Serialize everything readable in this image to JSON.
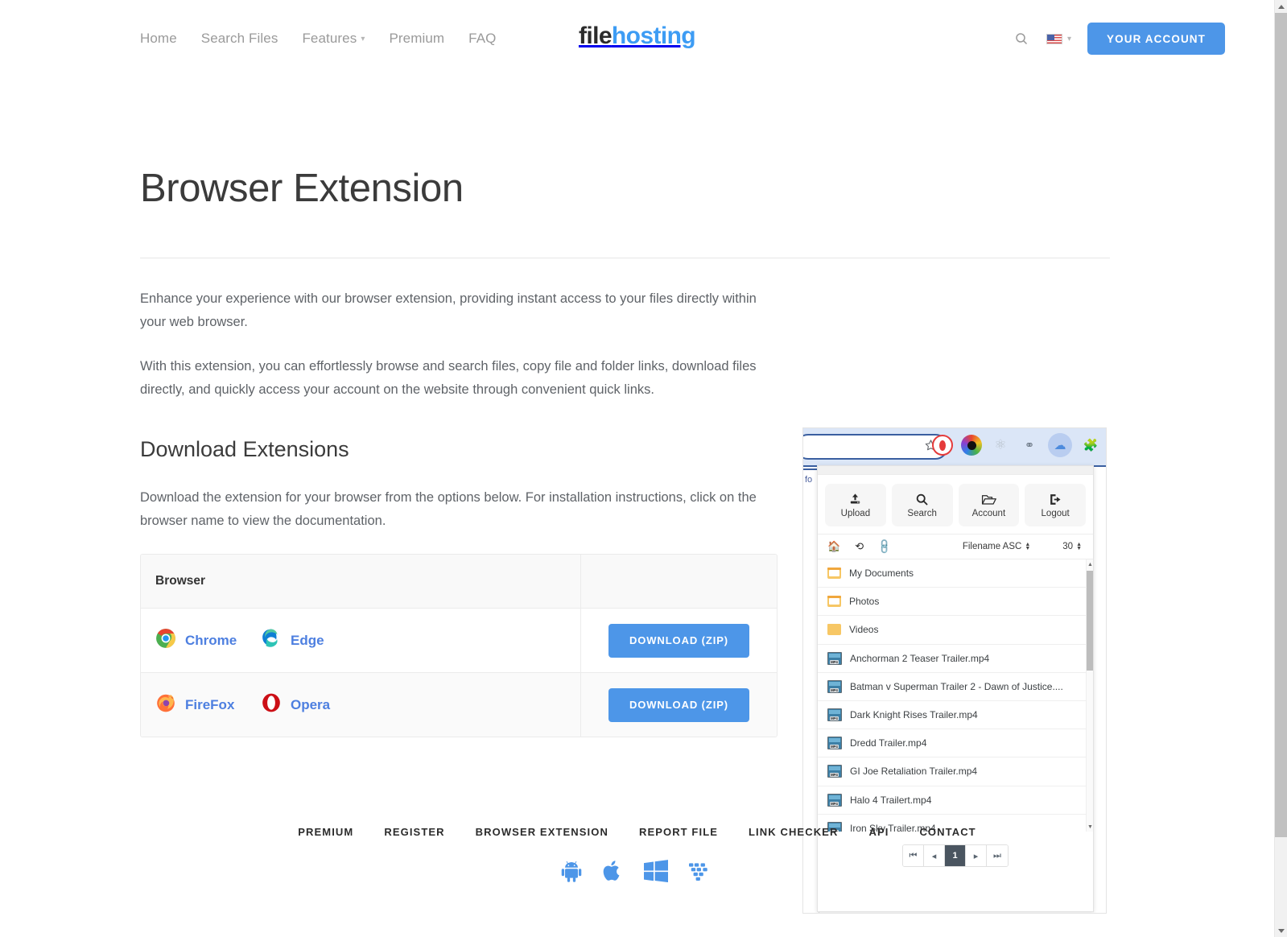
{
  "header": {
    "nav": [
      {
        "label": "Home",
        "has_caret": false
      },
      {
        "label": "Search Files",
        "has_caret": false
      },
      {
        "label": "Features",
        "has_caret": true
      },
      {
        "label": "Premium",
        "has_caret": false
      },
      {
        "label": "FAQ",
        "has_caret": false
      }
    ],
    "logo": {
      "part1": "file",
      "part2": "hosting"
    },
    "search_icon": "search-icon",
    "language_flag": "us-flag-icon",
    "account_button": "YOUR ACCOUNT"
  },
  "main": {
    "page_title": "Browser Extension",
    "intro_paragraph": "Enhance your experience with our browser extension, providing instant access to your files directly within your web browser.",
    "features_paragraph": "With this extension, you can effortlessly browse and search files, copy file and folder links, download files directly, and quickly access your account on the website through convenient quick links.",
    "section_title": "Download Extensions",
    "section_paragraph": "Download the extension for your browser from the options below. For installation instructions, click on the browser name to view the documentation."
  },
  "browser_table": {
    "header": {
      "col1": "Browser",
      "col2": ""
    },
    "rows": [
      {
        "browsers": [
          {
            "name": "Chrome",
            "icon": "chrome-icon"
          },
          {
            "name": "Edge",
            "icon": "edge-icon"
          }
        ],
        "download_label": "DOWNLOAD (ZIP)"
      },
      {
        "browsers": [
          {
            "name": "FireFox",
            "icon": "firefox-icon"
          },
          {
            "name": "Opera",
            "icon": "opera-icon"
          }
        ],
        "download_label": "DOWNLOAD (ZIP)"
      }
    ]
  },
  "extension_preview": {
    "behind_text": "fo",
    "toolbar_icons": [
      "opera-extension-icon",
      "color-ring-extension-icon",
      "atom-extension-icon",
      "gauge-lock-extension-icon",
      "cloud-extension-icon",
      "puzzle-extension-icon"
    ],
    "quick_actions": [
      {
        "label": "Upload",
        "icon": "upload-icon"
      },
      {
        "label": "Search",
        "icon": "search-icon"
      },
      {
        "label": "Account",
        "icon": "folder-open-icon"
      },
      {
        "label": "Logout",
        "icon": "logout-icon"
      }
    ],
    "list_toolbar": {
      "home_icon": "home-icon",
      "refresh_icon": "refresh-icon",
      "link_icon": "link-icon",
      "sort_value": "Filename ASC",
      "page_size": "30"
    },
    "files": [
      {
        "name": "My Documents",
        "type": "folder-open"
      },
      {
        "name": "Photos",
        "type": "folder-open"
      },
      {
        "name": "Videos",
        "type": "folder"
      },
      {
        "name": "Anchorman 2 Teaser Trailer.mp4",
        "type": "mp4"
      },
      {
        "name": "Batman v Superman Trailer 2 - Dawn of Justice....",
        "type": "mp4"
      },
      {
        "name": "Dark Knight Rises Trailer.mp4",
        "type": "mp4"
      },
      {
        "name": "Dredd Trailer.mp4",
        "type": "mp4"
      },
      {
        "name": "GI Joe Retaliation Trailer.mp4",
        "type": "mp4"
      },
      {
        "name": "Halo 4 Trailert.mp4",
        "type": "mp4"
      },
      {
        "name": "Iron Sky Trailer.mp4",
        "type": "mp4"
      }
    ],
    "pagination": {
      "first": "⏮",
      "prev": "◂",
      "current": "1",
      "next": "▸",
      "last": "⏭"
    }
  },
  "footer": {
    "links": [
      "PREMIUM",
      "REGISTER",
      "BROWSER EXTENSION",
      "REPORT FILE",
      "LINK CHECKER",
      "API",
      "CONTACT"
    ],
    "platform_icons": [
      "android-icon",
      "apple-icon",
      "windows-icon",
      "blackberry-icon"
    ]
  },
  "colors": {
    "accent_blue": "#4d96e8",
    "logo_blue": "#3d9cf4",
    "link_blue": "#4d7fe0",
    "text_gray": "#5f6368",
    "heading_gray": "#3b3b3b"
  }
}
